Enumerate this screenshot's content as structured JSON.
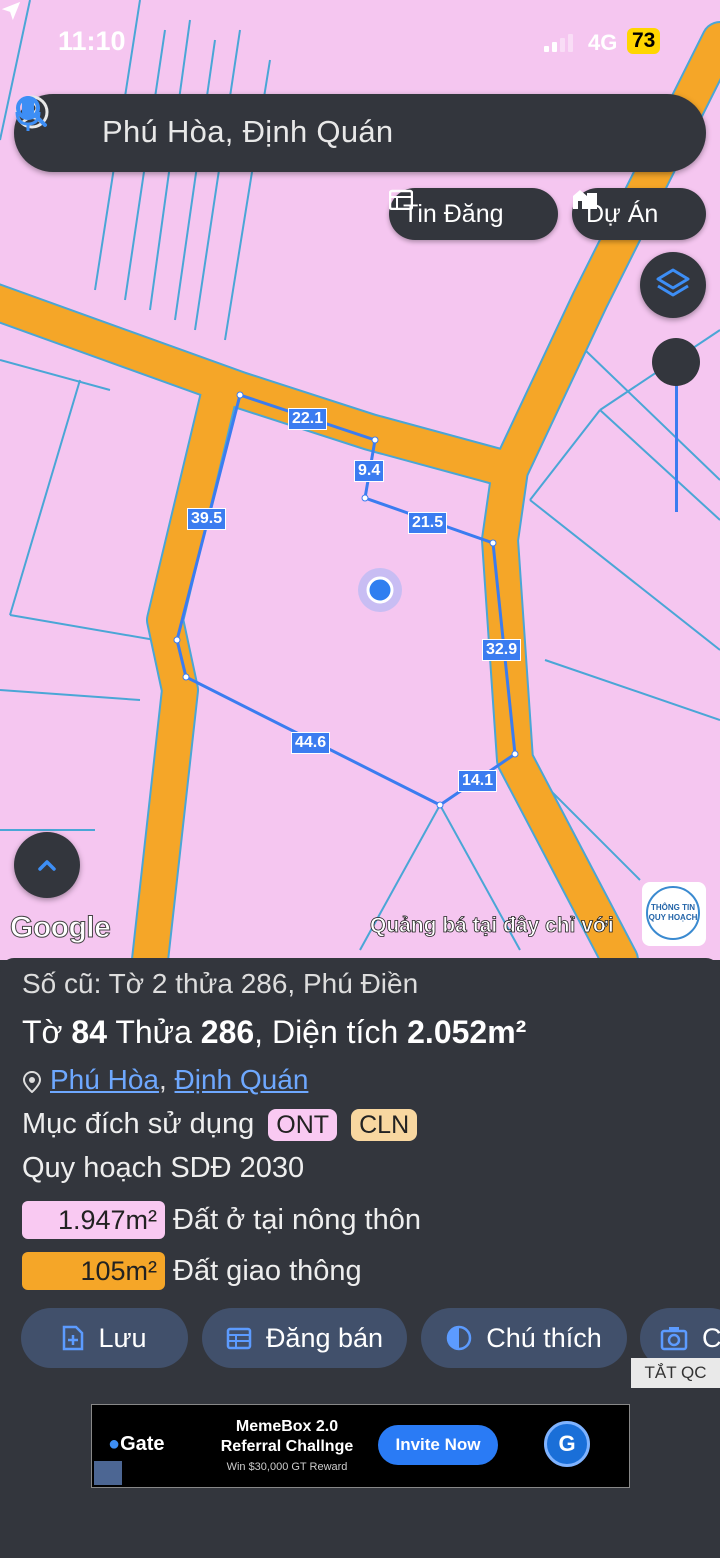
{
  "status": {
    "time": "11:10",
    "network": "4G",
    "battery": "73"
  },
  "search": {
    "text": "Phú Hòa, Định Quán"
  },
  "map_buttons": {
    "listing_label": "Tin Đăng",
    "project_label": "Dự Án"
  },
  "parcel_dimensions": [
    "22.1",
    "9.4",
    "21.5",
    "39.5",
    "32.9",
    "44.6",
    "14.1"
  ],
  "map_footer": {
    "google": "Google",
    "ad_text": "Quảng bá tại đây chỉ với",
    "logo_top": "THÔNG TIN",
    "logo_bottom": "QUY HOẠCH"
  },
  "parcel": {
    "old_info": "Số cũ: Tờ 2 thửa 286, Phú Điền",
    "sheet_prefix": "Tờ ",
    "sheet": "84",
    "lot_prefix": " Thửa ",
    "lot": "286",
    "area_prefix": ", Diện tích ",
    "area": "2.052m²",
    "commune": "Phú Hòa",
    "separator": ", ",
    "district": "Định Quán",
    "purpose_label": "Mục đích sử dụng",
    "purpose_tags": [
      {
        "code": "ONT",
        "color": "#f9c9f2"
      },
      {
        "code": "CLN",
        "color": "#f8d7a0"
      }
    ],
    "plan_label": "Quy hoạch SDĐ 2030",
    "land_use": [
      {
        "area": "1.947m²",
        "desc": "Đất ở tại nông thôn",
        "color": "#f9c9f2"
      },
      {
        "area": "105m²",
        "desc": "Đất giao thông",
        "color": "#f5a628"
      }
    ]
  },
  "actions": {
    "save": "Lưu",
    "post": "Đăng bán",
    "legend": "Chú thích",
    "more": "C"
  },
  "ad_hide": "TẮT QC",
  "ad": {
    "brand": "Gate",
    "title_line1": "MemeBox 2.0",
    "title_line2": "Referral Challnge",
    "subtitle": "Win $30,000 GT Reward",
    "cta": "Invite Now",
    "logo_letter": "G"
  },
  "colors": {
    "map_bg": "#f5c6f0",
    "road": "#f5a628",
    "parcel_line": "#3b7cf0",
    "panel_bg": "#33363d",
    "action_bg": "#41506b",
    "link": "#6ea8ff"
  }
}
